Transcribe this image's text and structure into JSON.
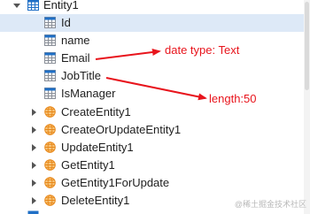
{
  "tree": {
    "root": {
      "label": "Entity1",
      "icon": "entity-table-icon",
      "expanded": true
    },
    "properties": [
      {
        "label": "Id",
        "icon": "property-grid-icon",
        "selected": true
      },
      {
        "label": "name",
        "icon": "property-grid-icon"
      },
      {
        "label": "Email",
        "icon": "property-grid-icon"
      },
      {
        "label": "JobTitle",
        "icon": "property-grid-icon"
      },
      {
        "label": "IsManager",
        "icon": "property-grid-icon"
      }
    ],
    "methods": [
      {
        "label": "CreateEntity1",
        "icon": "method-globe-icon"
      },
      {
        "label": "CreateOrUpdateEntity1",
        "icon": "method-globe-icon"
      },
      {
        "label": "UpdateEntity1",
        "icon": "method-globe-icon"
      },
      {
        "label": "GetEntity1",
        "icon": "method-globe-icon"
      },
      {
        "label": "GetEntity1ForUpdate",
        "icon": "method-globe-icon"
      },
      {
        "label": "DeleteEntity1",
        "icon": "method-globe-icon"
      }
    ]
  },
  "annotations": {
    "email_note": "date type: Text",
    "jobtitle_note": "length:50",
    "color": "#e8141c"
  },
  "colors": {
    "selection": "#dde9f7",
    "entity_icon": "#1f6fc6",
    "property_icon": "#8a8f98",
    "method_icon": "#e8891c"
  },
  "watermark": "@稀土掘金技术社区"
}
